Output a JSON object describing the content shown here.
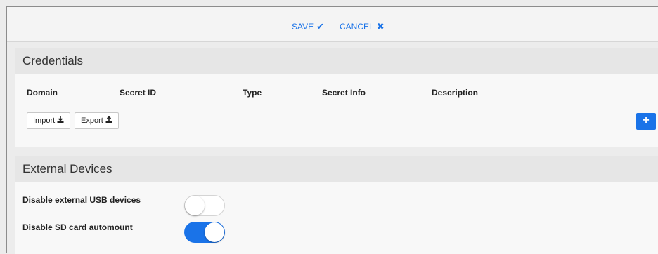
{
  "toolbar": {
    "save_label": "SAVE",
    "save_icon": "✔",
    "cancel_label": "CANCEL",
    "cancel_icon": "✖"
  },
  "credentials": {
    "title": "Credentials",
    "columns": [
      "Domain",
      "Secret ID",
      "Type",
      "Secret Info",
      "Description"
    ],
    "import_label": "Import",
    "export_label": "Export",
    "add_label": "+"
  },
  "external_devices": {
    "title": "External Devices",
    "settings": [
      {
        "label": "Disable external USB devices",
        "enabled": false
      },
      {
        "label": "Disable SD card automount",
        "enabled": true
      }
    ]
  },
  "colors": {
    "accent": "#1a73e8",
    "header_bg": "#e6e6e6",
    "page_bg": "#ececec"
  }
}
